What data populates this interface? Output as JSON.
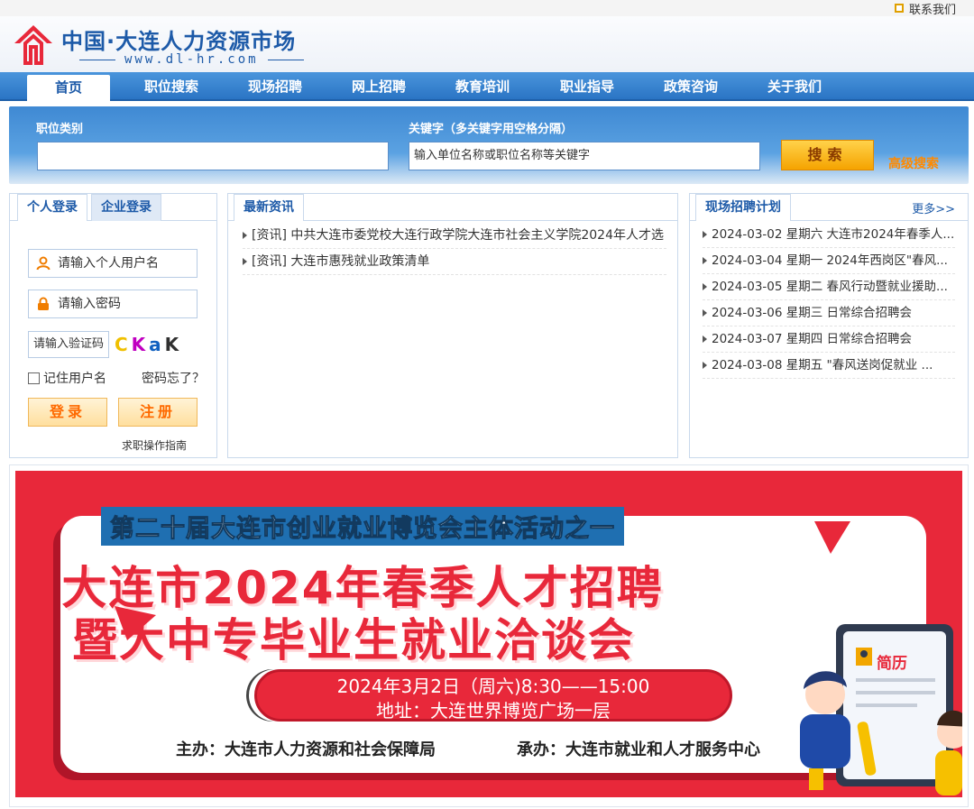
{
  "topbar": {
    "contact": "联系我们"
  },
  "header": {
    "title": "中国·大连人力资源市场",
    "url": "www.dl-hr.com"
  },
  "nav": [
    {
      "label": "首页",
      "active": true
    },
    {
      "label": "职位搜索"
    },
    {
      "label": "现场招聘"
    },
    {
      "label": "网上招聘"
    },
    {
      "label": "教育培训"
    },
    {
      "label": "职业指导"
    },
    {
      "label": "政策咨询"
    },
    {
      "label": "关于我们"
    }
  ],
  "search": {
    "category_label": "职位类别",
    "category_value": "",
    "keyword_label": "关键字（多关键字用空格分隔）",
    "keyword_value": "输入单位名称或职位名称等关键字",
    "button": "搜索",
    "advanced": "高级搜索"
  },
  "login": {
    "tab_personal": "个人登录",
    "tab_company": "企业登录",
    "username_placeholder": "请输入个人用户名",
    "password_placeholder": "请输入密码",
    "captcha_placeholder": "请输入验证码",
    "captcha_text": "CKaK",
    "remember": "记住用户名",
    "forgot": "密码忘了？",
    "login_button": "登录",
    "register_button": "注册",
    "guide": "求职操作指南"
  },
  "news": {
    "tab": "最新资讯",
    "items": [
      "[资讯] 中共大连市委党校大连行政学院大连市社会主义学院2024年人才选",
      "[资讯] 大连市惠残就业政策清单"
    ]
  },
  "plans": {
    "tab": "现场招聘计划",
    "more": "更多>>",
    "items": [
      "2024-03-02 星期六 大连市2024年春季人...",
      "2024-03-04 星期一 2024年西岗区\"春风...",
      "2024-03-05 星期二 春风行动暨就业援助...",
      "2024-03-06 星期三 日常综合招聘会",
      "2024-03-07 星期四 日常综合招聘会",
      "2024-03-08 星期五 \"春风送岗促就业 ..."
    ]
  },
  "banner": {
    "subtitle": "第二十届大连市创业就业博览会主体活动之一",
    "line1": "大连市2024年春季人才招聘",
    "line2": "暨大中专毕业生就业洽谈会",
    "time": "2024年3月2日（周六)8:30——15:00",
    "address": "地址：大连世界博览广场一层",
    "host": "主办：大连市人力资源和社会保障局",
    "co_host": "承办：大连市就业和人才服务中心",
    "resume": "简历"
  },
  "colors": {
    "nav_blue": "#2a74c4",
    "brand_blue": "#1d5aa8",
    "banner_red": "#e8283a",
    "orange": "#ff8a00"
  }
}
